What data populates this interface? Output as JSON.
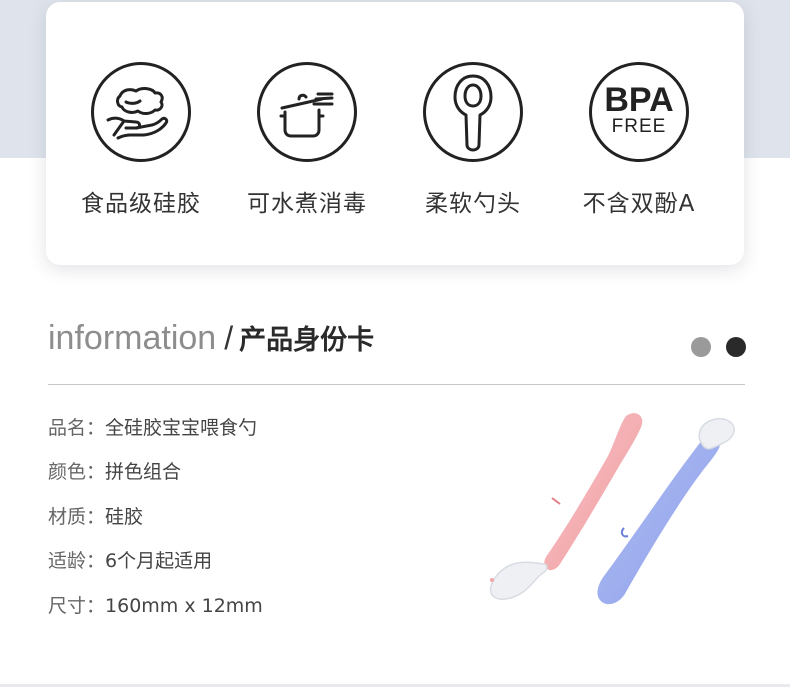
{
  "features": [
    {
      "icon": "hand-holding-silicone-icon",
      "label": "食品级硅胶"
    },
    {
      "icon": "boiling-pot-icon",
      "label": "可水煮消毒"
    },
    {
      "icon": "soft-spoon-head-icon",
      "label": "柔软勺头"
    },
    {
      "icon": "bpa-free-icon",
      "label": "不含双酚A",
      "badge_main": "BPA",
      "badge_sub": "FREE"
    }
  ],
  "info": {
    "title_en": "information",
    "separator": "/",
    "title_cn": "产品身份卡"
  },
  "specs": [
    {
      "key": "品名：",
      "value": "全硅胶宝宝喂食勺"
    },
    {
      "key": "颜色：",
      "value": "拼色组合"
    },
    {
      "key": "材质：",
      "value": "硅胶"
    },
    {
      "key": "适龄：",
      "value": "6个月起适用"
    },
    {
      "key": "尺寸：",
      "value": "160mm x 12mm"
    }
  ],
  "colors": {
    "band": "#dfe4ec",
    "pink_spoon": "#f2a3a8",
    "blue_spoon": "#8fa3ee",
    "dot_gray": "#9a9a9a",
    "dot_dark": "#2a2a2a"
  }
}
